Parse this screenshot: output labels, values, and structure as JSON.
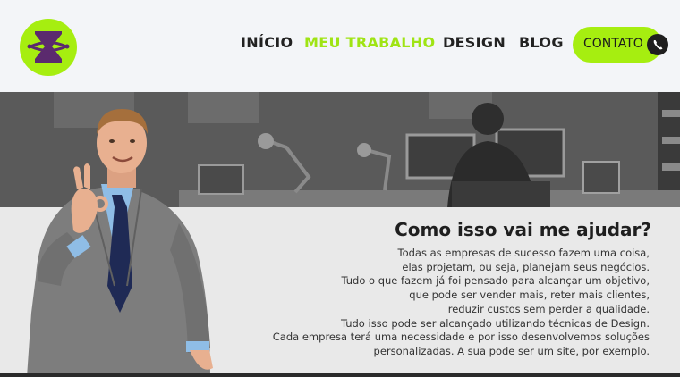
{
  "nav": {
    "items": [
      {
        "label": "INÍCIO",
        "active": false
      },
      {
        "label": "MEU TRABALHO",
        "active": true
      },
      {
        "label": "DESIGN",
        "active": false
      },
      {
        "label": "BLOG",
        "active": false
      }
    ],
    "contact_label": "CONTATO"
  },
  "content": {
    "heading": "Como isso vai me ajudar?",
    "lines": [
      "Todas as empresas de sucesso fazem uma coisa,",
      "elas projetam, ou seja, planejam seus negócios.",
      "Tudo o que fazem já foi pensado para alcançar um objetivo,",
      "que pode ser vender mais, reter mais clientes,",
      "reduzir custos sem perder a qualidade.",
      "Tudo isso pode ser alcançado utilizando técnicas de Design.",
      "Cada empresa terá uma necessidade e por isso desenvolvemos soluções",
      "personalizadas. A sua pode ser um site, por exemplo."
    ]
  },
  "colors": {
    "accent": "#a6ee10",
    "logo_mark": "#5b2a6e",
    "text_dark": "#222222"
  },
  "icons": {
    "logo": "hourglass-logo",
    "contact": "whatsapp-icon"
  }
}
